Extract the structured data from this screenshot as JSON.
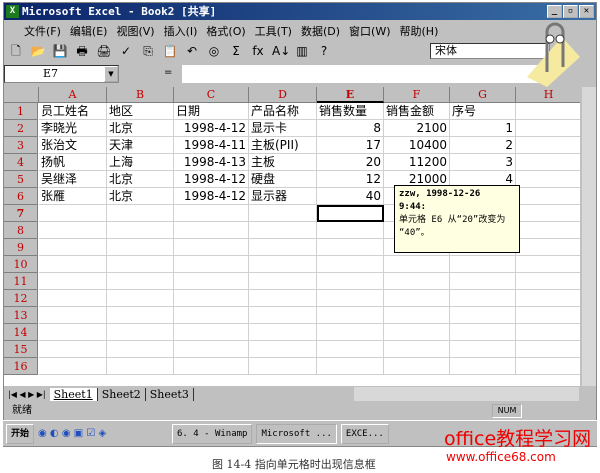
{
  "window": {
    "title": "Microsoft Excel - Book2  [共享]",
    "minimize": "_",
    "restore": "▫",
    "close": "✕"
  },
  "menu": [
    "文件(F)",
    "编辑(E)",
    "视图(V)",
    "插入(I)",
    "格式(O)",
    "工具(T)",
    "数据(D)",
    "窗口(W)",
    "帮助(H)"
  ],
  "toolbar": {
    "icons": [
      "new-icon",
      "open-icon",
      "save-icon",
      "print-icon",
      "print-preview-icon",
      "spelling-icon",
      "copy-icon",
      "paste-icon",
      "undo-icon",
      "web-icon",
      "autosum-icon",
      "function-icon",
      "sort-ascending-icon",
      "chart-wizard-icon",
      "help-icon"
    ],
    "glyphs": [
      "🗋",
      "📂",
      "💾",
      "🖶",
      "🖨",
      "✓",
      "⎘",
      "📋",
      "↶",
      "◎",
      "Σ",
      "fx",
      "A↓",
      "▥",
      "?"
    ],
    "font": "宋体"
  },
  "formula_bar": {
    "name_box": "E7",
    "equals": "=",
    "content": ""
  },
  "columns": [
    "A",
    "B",
    "C",
    "D",
    "E",
    "F",
    "G",
    "H"
  ],
  "rows": [
    "1",
    "2",
    "3",
    "4",
    "5",
    "6",
    "7",
    "8",
    "9",
    "10",
    "11",
    "12",
    "13",
    "14",
    "15",
    "16"
  ],
  "cells": [
    [
      "员工姓名",
      "地区",
      "日期",
      "产品名称",
      "销售数量",
      "销售金额",
      "序号"
    ],
    [
      "李晓光",
      "北京",
      "1998-4-12",
      "显示卡",
      "8",
      "2100",
      "1"
    ],
    [
      "张治文",
      "天津",
      "1998-4-11",
      "主板(PII)",
      "17",
      "10400",
      "2"
    ],
    [
      "扬帆",
      "上海",
      "1998-4-13",
      "主板",
      "20",
      "11200",
      "3"
    ],
    [
      "吴继泽",
      "北京",
      "1998-4-12",
      "硬盘",
      "12",
      "21000",
      "4"
    ],
    [
      "张雁",
      "北京",
      "1998-4-12",
      "显示器",
      "40",
      "",
      ""
    ]
  ],
  "comment": {
    "line1": "zzw, 1998-12-26",
    "line2": "9:44:",
    "line3": "单元格 E6 从“20”改变为",
    "line4": "“40”。"
  },
  "sheets": [
    "Sheet1",
    "Sheet2",
    "Sheet3"
  ],
  "status": {
    "ready": "就绪",
    "num": "NUM"
  },
  "taskbar": {
    "start": "开始",
    "items": [
      "6. 4 - Winamp",
      "Microsoft ...",
      "EXCE..."
    ]
  },
  "watermark": {
    "text": "office教程学习网",
    "url": "www.office68.com"
  },
  "caption": "图 14-4  指向单元格时出现信息框"
}
